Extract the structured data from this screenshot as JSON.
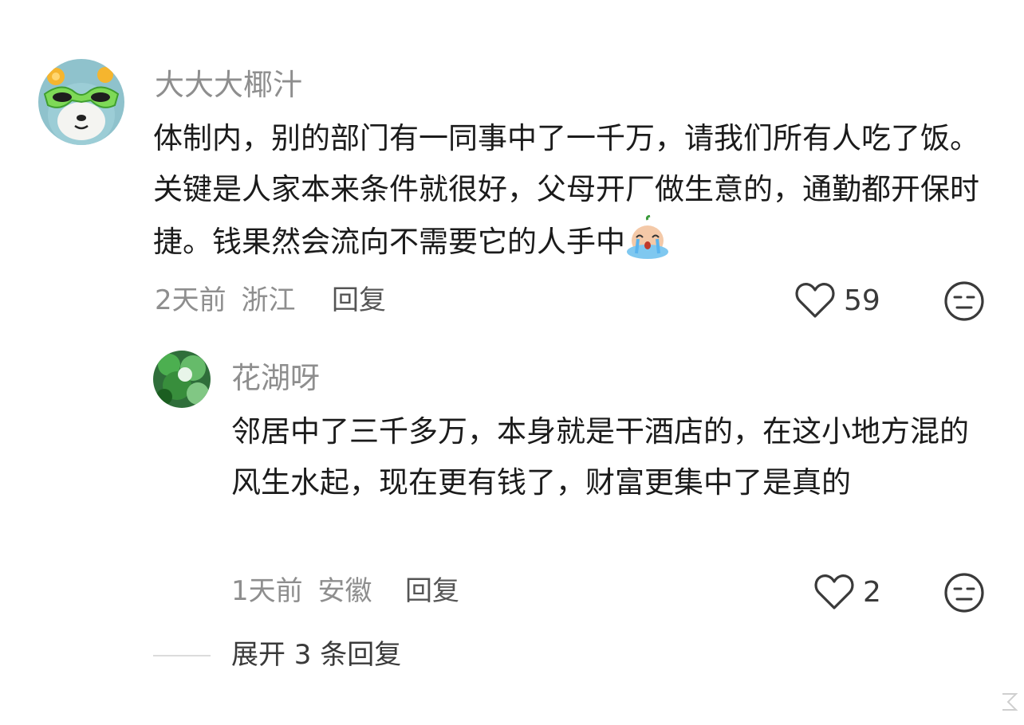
{
  "comments": [
    {
      "username": "大大大椰汁",
      "content": "体制内，别的部门有一同事中了一千万，请我们所有人吃了饭。关键是人家本来条件就很好，父母开厂做生意的，通勤都开保时捷。钱果然会流向不需要它的人手中",
      "time": "2天前",
      "location": "浙江",
      "reply_label": "回复",
      "likes": "59",
      "emoji": "crying-emoji"
    },
    {
      "username": "花湖呀",
      "content": "邻居中了三千多万，本身就是干酒店的，在这小地方混的风生水起，现在更有钱了，财富更集中了是真的",
      "time": "1天前",
      "location": "安徽",
      "reply_label": "回复",
      "likes": "2"
    }
  ],
  "expand": {
    "label": "展开 3 条回复"
  },
  "icons": {
    "like": "heart-outline-icon",
    "dislike": "neutral-face-icon"
  },
  "colors": {
    "muted_text": "#8e8e8e",
    "body_text": "#1b1b1b",
    "icon_stroke": "#3a3a3a"
  }
}
